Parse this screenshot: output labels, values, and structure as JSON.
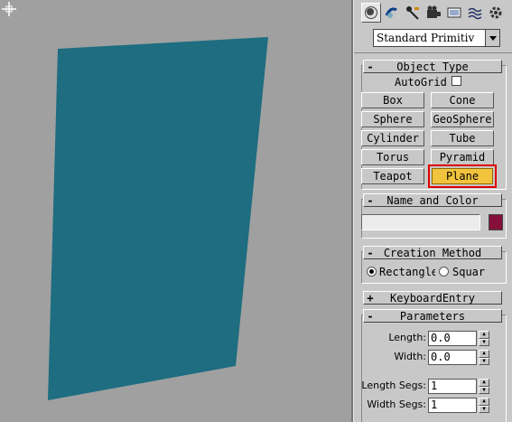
{
  "viewport": {
    "plane_color": "#1e6d80",
    "background_color": "#a0a0a0"
  },
  "tabs": [
    {
      "name": "create-tab-icon",
      "active": true
    },
    {
      "name": "modify-tab-icon",
      "active": false
    },
    {
      "name": "hierarchy-tab-icon",
      "active": false
    },
    {
      "name": "motion-tab-icon",
      "active": false
    },
    {
      "name": "display-tab-icon",
      "active": false
    },
    {
      "name": "utilities-tab-icon",
      "active": false
    },
    {
      "name": "settings-tab-icon",
      "active": false
    }
  ],
  "category_dropdown": {
    "value": "Standard Primitiv"
  },
  "object_type": {
    "title": "Object Type",
    "autogrid_label": "AutoGrid",
    "buttons": {
      "box": "Box",
      "cone": "Cone",
      "sphere": "Sphere",
      "geosphere": "GeoSphere",
      "cylinder": "Cylinder",
      "tube": "Tube",
      "torus": "Torus",
      "pyramid": "Pyramid",
      "teapot": "Teapot",
      "plane": "Plane"
    },
    "active_button": "plane",
    "highlight_color": "#e00000"
  },
  "name_and_color": {
    "title": "Name and Color",
    "name_value": "",
    "color": "#85103a"
  },
  "creation_method": {
    "title": "Creation Method",
    "options": [
      "Rectangle",
      "Squar"
    ],
    "selected": "Rectangle"
  },
  "keyboard_entry": {
    "title": "KeyboardEntry"
  },
  "parameters": {
    "title": "Parameters",
    "length_label": "Length:",
    "length_value": "0.0",
    "width_label": "Width:",
    "width_value": "0.0",
    "length_segs_label": "Length Segs:",
    "length_segs_value": "1",
    "width_segs_label": "Width Segs:",
    "width_segs_value": "1"
  },
  "rollout_signs": {
    "expanded": "-",
    "collapsed": "+"
  }
}
